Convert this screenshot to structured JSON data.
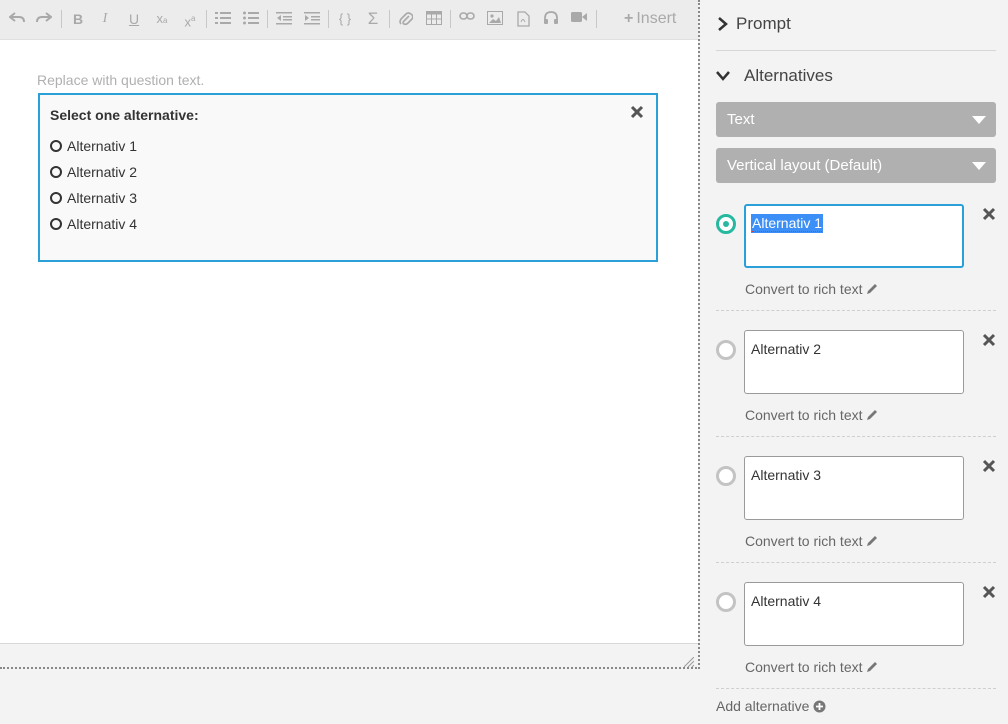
{
  "toolbar": {
    "insert_label": "Insert"
  },
  "editor": {
    "placeholder": "Replace with question text.",
    "question": {
      "heading": "Select one alternative:",
      "alternatives": [
        "Alternativ 1",
        "Alternativ 2",
        "Alternativ 3",
        "Alternativ 4"
      ]
    }
  },
  "panel": {
    "prompt_label": "Prompt",
    "alternatives_label": "Alternatives",
    "type_select": "Text",
    "layout_select": "Vertical layout (Default)",
    "items": [
      {
        "value": "Alternativ 1",
        "convert_label": "Convert to rich text",
        "correct": true
      },
      {
        "value": "Alternativ 2",
        "convert_label": "Convert to rich text",
        "correct": false
      },
      {
        "value": "Alternativ 3",
        "convert_label": "Convert to rich text",
        "correct": false
      },
      {
        "value": "Alternativ 4",
        "convert_label": "Convert to rich text",
        "correct": false
      }
    ],
    "add_label": "Add alternative"
  },
  "colors": {
    "accent_blue": "#2a9fd8",
    "correct_green": "#27b9a0",
    "select_gray": "#b0b0b0"
  }
}
